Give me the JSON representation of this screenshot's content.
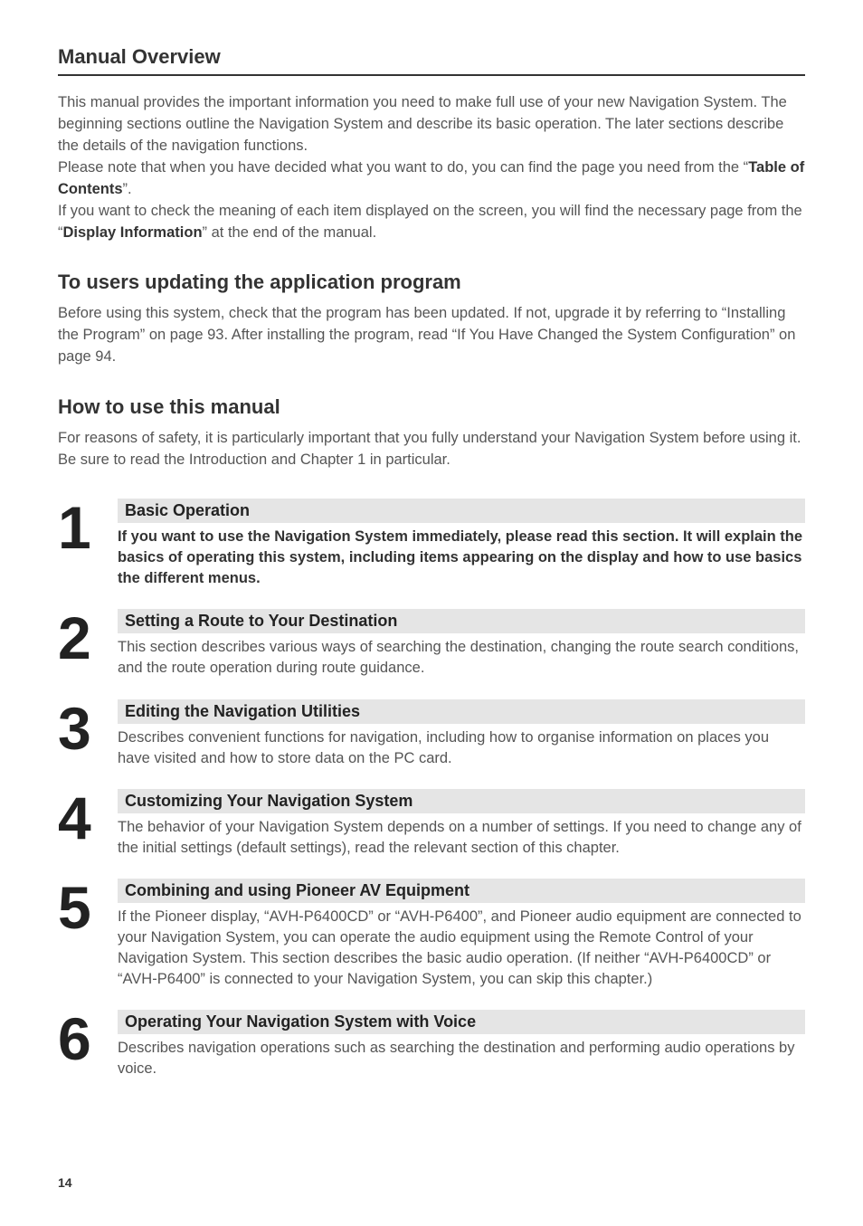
{
  "title": "Manual Overview",
  "intro": {
    "p1a": "This manual provides the important information you need to make full use of your new Navigation System. The beginning sections outline the Navigation System and describe its basic operation. The later sections describe the details of the navigation functions.",
    "p1b_pre": "Please note that when you have decided what you want to do, you can find the page you need from the “",
    "p1b_bold": "Table of Contents",
    "p1b_post": "”.",
    "p1c_pre": "If you want to check the meaning of each item displayed on the screen, you will find the necessary page from the “",
    "p1c_bold": "Display Information",
    "p1c_post": "” at the end of the manual."
  },
  "section2": {
    "heading": "To users updating the application program",
    "body": "Before using this system, check that the program has been updated. If not, upgrade it by referring to “Installing the Program” on page 93. After installing the program, read “If You Have Changed the System Configuration” on page 94."
  },
  "section3": {
    "heading": "How to use this manual",
    "body": "For reasons of safety, it is particularly important that you fully understand your Navigation System before using it. Be sure to read the Introduction and Chapter 1 in particular."
  },
  "chapters": [
    {
      "num": "1",
      "title": "Basic Operation",
      "text": "If you want to use the Navigation System immediately, please read this section. It will explain the basics of operating this system, including items appearing on the display and how to use basics the different menus.",
      "bold": true
    },
    {
      "num": "2",
      "title": "Setting a Route to Your Destination",
      "text": "This section describes various ways of searching the destination, changing the route search conditions, and the route operation during route guidance.",
      "bold": false
    },
    {
      "num": "3",
      "title": "Editing the Navigation Utilities",
      "text": "Describes convenient functions for navigation, including how to organise information on places you have visited and how to store data on the PC card.",
      "bold": false
    },
    {
      "num": "4",
      "title": "Customizing Your Navigation System",
      "text": "The behavior of your Navigation System depends on a number of settings. If you need to change any of the initial settings (default settings), read the relevant section of this chapter.",
      "bold": false
    },
    {
      "num": "5",
      "title": "Combining and using Pioneer AV Equipment",
      "text": "If the Pioneer display, “AVH-P6400CD” or “AVH-P6400”, and Pioneer audio equipment are connected to your Navigation System, you can operate the audio equipment using the Remote Control of your Navigation System. This section describes the basic audio operation. (If neither “AVH-P6400CD” or “AVH-P6400” is connected to your Navigation System, you can skip this chapter.)",
      "bold": false
    },
    {
      "num": "6",
      "title": "Operating Your Navigation System with Voice",
      "text": "Describes navigation operations such as searching the destination and performing audio operations by voice.",
      "bold": false
    }
  ],
  "page_number": "14"
}
